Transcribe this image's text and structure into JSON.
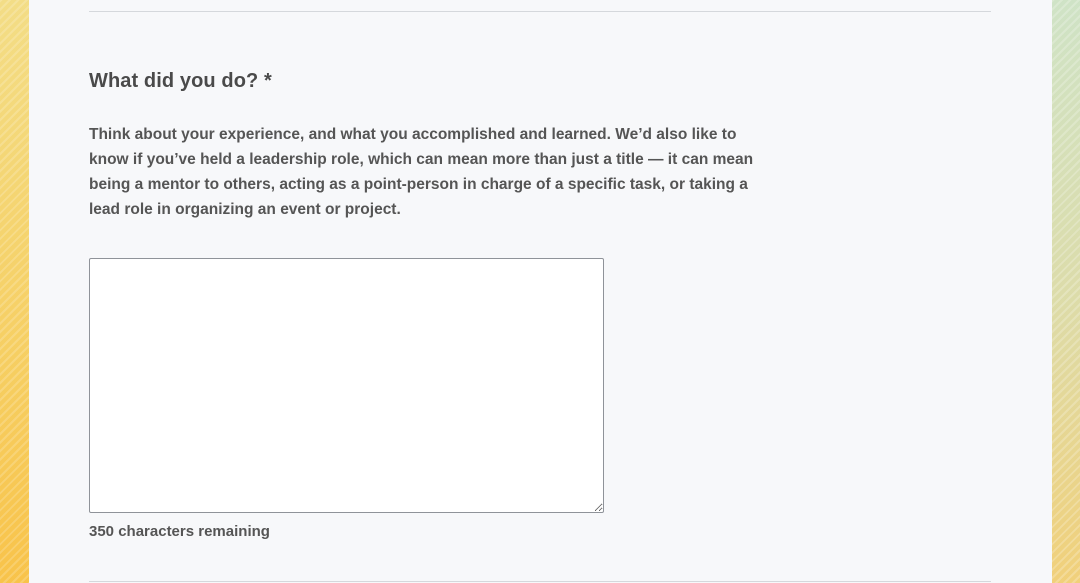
{
  "question": {
    "title": "What did you do? *",
    "help_text": "Think about your experience, and what you accomplished and learned. We’d also like to know if you’ve held a leadership role, which can mean more than just a title — it can mean being a mentor to others, acting as a point-person in charge of a specific task, or taking a lead role in organizing an event or project.",
    "answer_value": "",
    "char_counter": "350 characters remaining"
  },
  "colors": {
    "panel_background": "#f7f8fa",
    "text": "#555555",
    "heading": "#4a4a4a",
    "backdrop_left": "#f8c34a",
    "backdrop_right": "#cfe3c6"
  }
}
